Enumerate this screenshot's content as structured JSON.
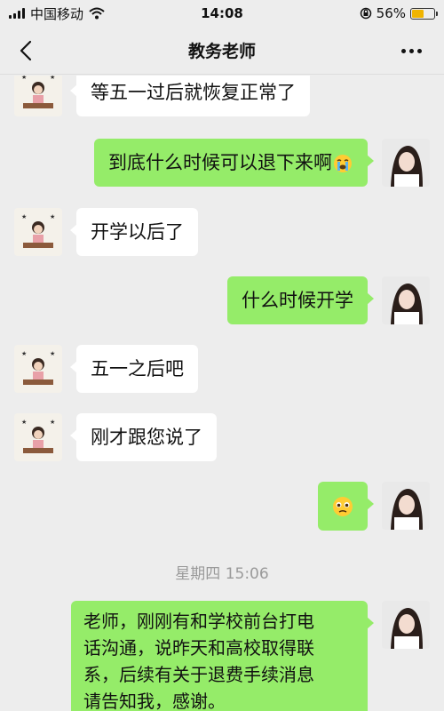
{
  "status_bar": {
    "carrier": "中国移动",
    "time": "14:08",
    "battery": "56%",
    "battery_level": 0.56,
    "battery_color": "#f0b400"
  },
  "nav": {
    "title": "教务老师",
    "back_icon": "chevron-left-icon",
    "more_icon": "more-dots-icon"
  },
  "messages": [
    {
      "side": "left",
      "sender": "teacher",
      "text": "等五一过后就恢复正常了"
    },
    {
      "side": "right",
      "sender": "me",
      "text": "到底什么时候可以退下来啊",
      "emoji": "crying-face-icon"
    },
    {
      "side": "left",
      "sender": "teacher",
      "text": "开学以后了"
    },
    {
      "side": "right",
      "sender": "me",
      "text": "什么时候开学"
    },
    {
      "side": "left",
      "sender": "teacher",
      "text": "五一之后吧"
    },
    {
      "side": "left",
      "sender": "teacher",
      "text": "刚才跟您说了"
    },
    {
      "side": "right",
      "sender": "me",
      "text": "",
      "emoji": "pleading-face-icon"
    }
  ],
  "timestamp": "星期四 15:06",
  "last_message": {
    "side": "right",
    "sender": "me",
    "lines": [
      "老师，刚刚有和学校前台打电",
      "话沟通，说昨天和高校取得联",
      "系，后续有关于退费手续消息",
      "请告知我，感谢。"
    ]
  },
  "colors": {
    "background": "#ededed",
    "outgoing_bubble": "#95ec69",
    "incoming_bubble": "#ffffff",
    "timestamp_text": "#9a9a9a"
  }
}
